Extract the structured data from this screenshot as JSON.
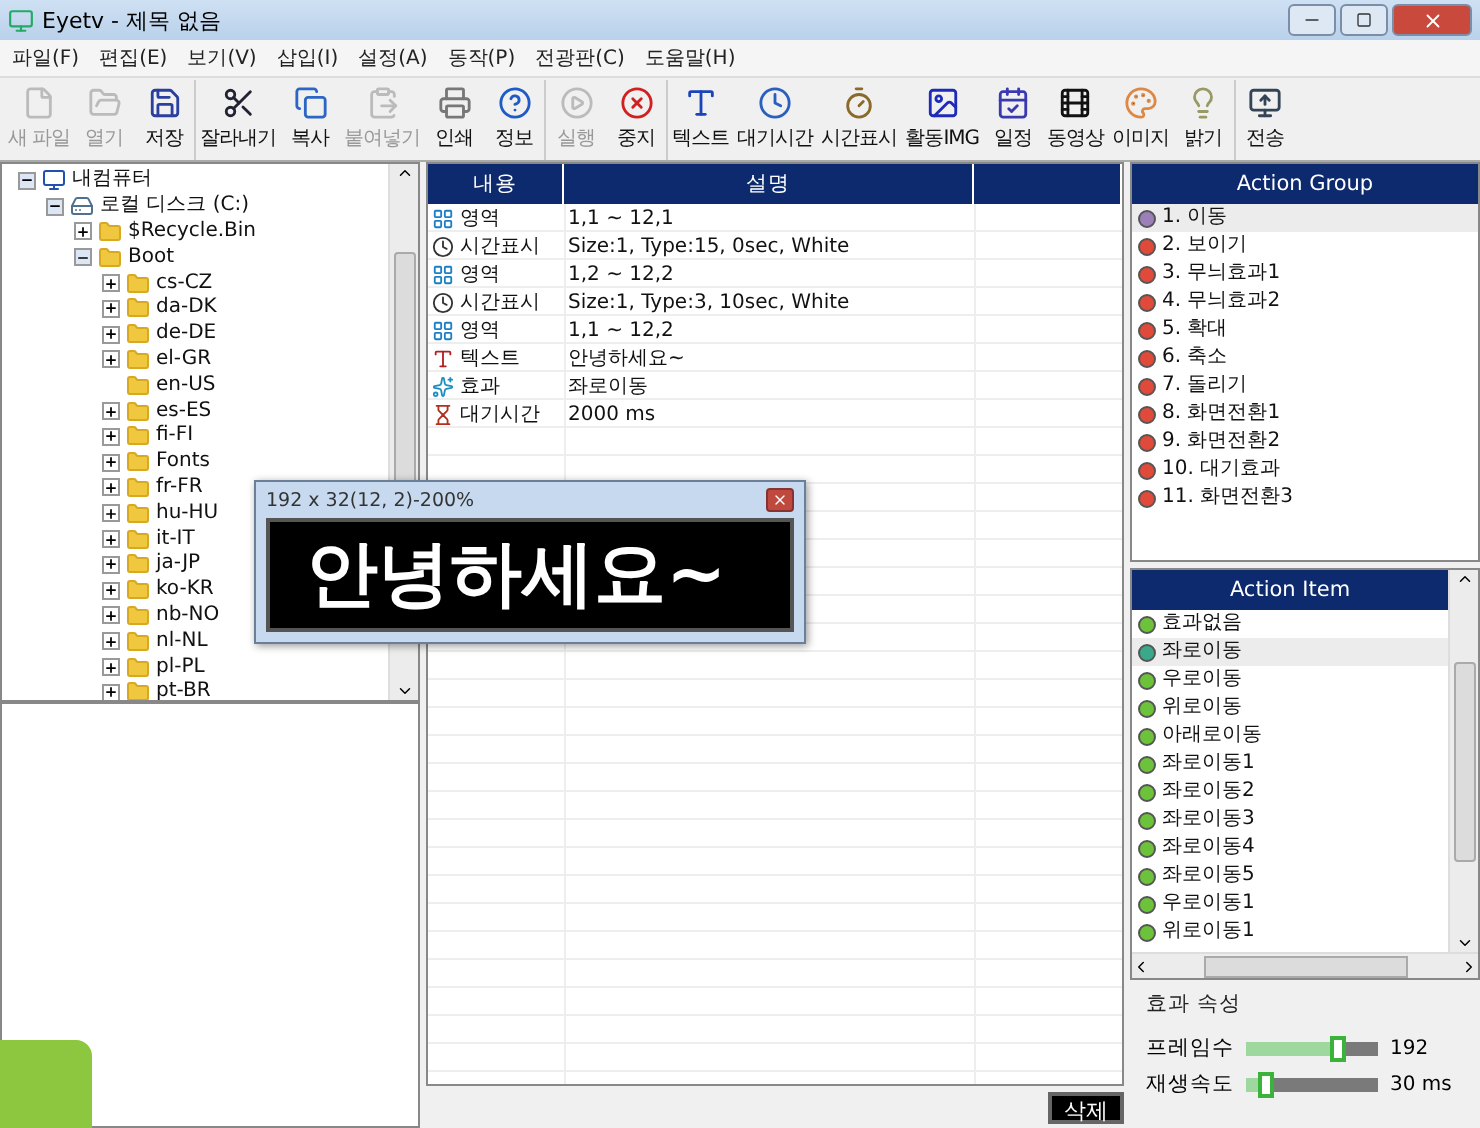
{
  "window": {
    "title": "Eyetv - 제목 없음"
  },
  "menu": [
    "파일(F)",
    "편집(E)",
    "보기(V)",
    "삽입(I)",
    "설정(A)",
    "동작(P)",
    "전광판(C)",
    "도움말(H)"
  ],
  "toolbar": [
    [
      {
        "label": "새 파일",
        "disabled": true
      },
      {
        "label": "열기",
        "disabled": true
      },
      {
        "label": "저장",
        "disabled": false
      }
    ],
    [
      {
        "label": "잘라내기",
        "disabled": false
      },
      {
        "label": "복사",
        "disabled": false
      },
      {
        "label": "붙여넣기",
        "disabled": true
      },
      {
        "label": "인쇄",
        "disabled": false
      },
      {
        "label": "정보",
        "disabled": false
      }
    ],
    [
      {
        "label": "실행",
        "disabled": true
      },
      {
        "label": "중지",
        "disabled": false
      }
    ],
    [
      {
        "label": "텍스트",
        "disabled": false
      },
      {
        "label": "대기시간",
        "disabled": false
      },
      {
        "label": "시간표시",
        "disabled": false
      },
      {
        "label": "활동IMG",
        "disabled": false
      },
      {
        "label": "일정",
        "disabled": false
      },
      {
        "label": "동영상",
        "disabled": false
      },
      {
        "label": "이미지",
        "disabled": false
      },
      {
        "label": "밝기",
        "disabled": false
      }
    ],
    [
      {
        "label": "전송",
        "disabled": false
      }
    ]
  ],
  "tree": [
    {
      "label": "내컴퓨터",
      "kind": "computer",
      "expanded": true,
      "children": [
        {
          "label": "로컬 디스크 (C:)",
          "kind": "drive",
          "expanded": true,
          "children": [
            {
              "label": "$Recycle.Bin",
              "kind": "folder",
              "expanded": false
            },
            {
              "label": "Boot",
              "kind": "folder",
              "expanded": true,
              "children": [
                {
                  "label": "cs-CZ",
                  "kind": "folder",
                  "expanded": false
                },
                {
                  "label": "da-DK",
                  "kind": "folder",
                  "expanded": false
                },
                {
                  "label": "de-DE",
                  "kind": "folder",
                  "expanded": false
                },
                {
                  "label": "el-GR",
                  "kind": "folder",
                  "expanded": false
                },
                {
                  "label": "en-US",
                  "kind": "leaf",
                  "expanded": false
                },
                {
                  "label": "es-ES",
                  "kind": "folder",
                  "expanded": false
                },
                {
                  "label": "fi-FI",
                  "kind": "folder",
                  "expanded": false
                },
                {
                  "label": "Fonts",
                  "kind": "folder",
                  "expanded": false
                },
                {
                  "label": "fr-FR",
                  "kind": "folder",
                  "expanded": false
                },
                {
                  "label": "hu-HU",
                  "kind": "folder",
                  "expanded": false
                },
                {
                  "label": "it-IT",
                  "kind": "folder",
                  "expanded": false
                },
                {
                  "label": "ja-JP",
                  "kind": "folder",
                  "expanded": false
                },
                {
                  "label": "ko-KR",
                  "kind": "folder",
                  "expanded": false
                },
                {
                  "label": "nb-NO",
                  "kind": "folder",
                  "expanded": false
                },
                {
                  "label": "nl-NL",
                  "kind": "folder",
                  "expanded": false
                },
                {
                  "label": "pl-PL",
                  "kind": "folder",
                  "expanded": false
                },
                {
                  "label": "pt-BR",
                  "kind": "folder",
                  "expanded": false
                }
              ]
            }
          ]
        }
      ]
    }
  ],
  "table": {
    "columns": [
      "내용",
      "설명"
    ],
    "rows": [
      {
        "kind": "area",
        "content": "영역",
        "description": "1,1 ~ 12,1"
      },
      {
        "kind": "clock",
        "content": "시간표시",
        "description": "Size:1, Type:15, 0sec, White"
      },
      {
        "kind": "area",
        "content": "영역",
        "description": "1,2 ~ 12,2"
      },
      {
        "kind": "clock",
        "content": "시간표시",
        "description": "Size:1, Type:3, 10sec, White"
      },
      {
        "kind": "area",
        "content": "영역",
        "description": "1,1 ~ 12,2"
      },
      {
        "kind": "text",
        "content": "텍스트",
        "description": "안녕하세요~"
      },
      {
        "kind": "effect",
        "content": "효과",
        "description": "좌로이동"
      },
      {
        "kind": "wait",
        "content": "대기시간",
        "description": "2000 ms"
      }
    ]
  },
  "delete_button": "삭제",
  "action_group": {
    "title": "Action Group",
    "items": [
      {
        "label": "1. 이동",
        "selected": true
      },
      {
        "label": "2. 보이기",
        "selected": false
      },
      {
        "label": "3. 무늬효과1",
        "selected": false
      },
      {
        "label": "4. 무늬효과2",
        "selected": false
      },
      {
        "label": "5. 확대",
        "selected": false
      },
      {
        "label": "6. 축소",
        "selected": false
      },
      {
        "label": "7. 돌리기",
        "selected": false
      },
      {
        "label": "8. 화면전환1",
        "selected": false
      },
      {
        "label": "9. 화면전환2",
        "selected": false
      },
      {
        "label": "10. 대기효과",
        "selected": false
      },
      {
        "label": "11. 화면전환3",
        "selected": false
      }
    ]
  },
  "action_item": {
    "title": "Action Item",
    "items": [
      {
        "label": "효과없음",
        "selected": false
      },
      {
        "label": "좌로이동",
        "selected": true
      },
      {
        "label": "우로이동",
        "selected": false
      },
      {
        "label": "위로이동",
        "selected": false
      },
      {
        "label": "아래로이동",
        "selected": false
      },
      {
        "label": "좌로이동1",
        "selected": false
      },
      {
        "label": "좌로이동2",
        "selected": false
      },
      {
        "label": "좌로이동3",
        "selected": false
      },
      {
        "label": "좌로이동4",
        "selected": false
      },
      {
        "label": "좌로이동5",
        "selected": false
      },
      {
        "label": "우로이동1",
        "selected": false
      },
      {
        "label": "위로이동1",
        "selected": false
      }
    ]
  },
  "effect_properties": {
    "title": "효과 속성",
    "sliders": [
      {
        "label": "프레임수",
        "level": 0.7,
        "reading": "192"
      },
      {
        "label": "재생속도",
        "level": 0.15,
        "reading": "30 ms"
      }
    ]
  },
  "preview": {
    "title": "192 x 32(12, 2)-200%",
    "text": "안녕하세요~"
  }
}
